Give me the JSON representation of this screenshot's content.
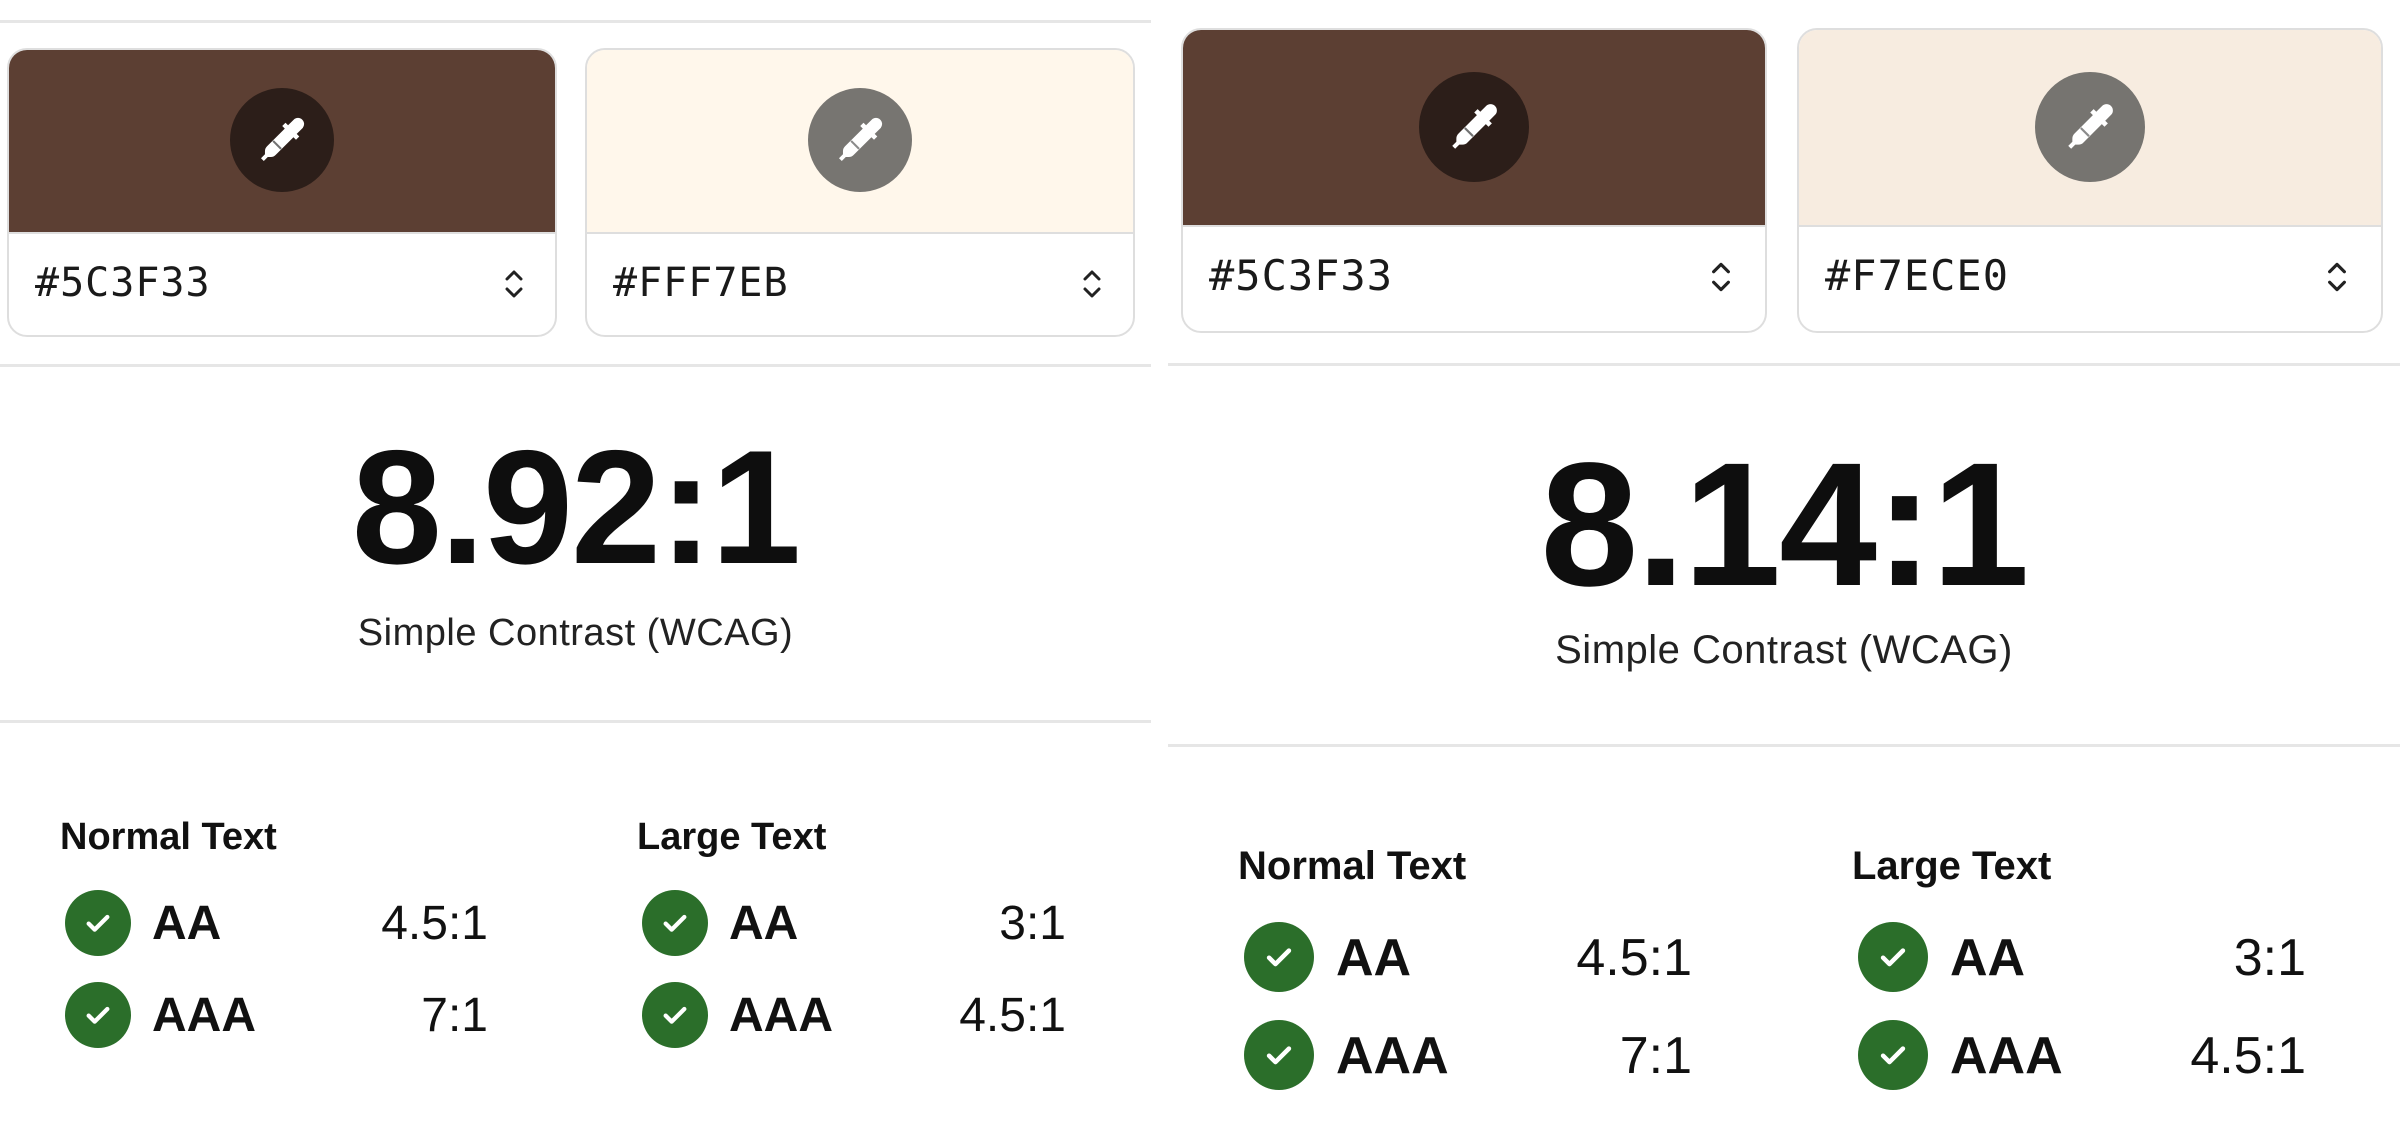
{
  "colors": {
    "accent_check": "#2B6E2A",
    "divider": "#E6E6E6"
  },
  "left": {
    "foreground": {
      "hex": "#5C3F33",
      "swatch": "#5C3F33",
      "picker_bg": "#2C1E19",
      "icon": "eyedropper-icon"
    },
    "background": {
      "hex": "#FFF7EB",
      "swatch": "#FFF7EB",
      "picker_bg": "#777571",
      "icon": "eyedropper-icon"
    },
    "ratio": "8.92:1",
    "ratio_label": "Simple Contrast (WCAG)",
    "normal_text": {
      "title": "Normal Text",
      "rows": [
        {
          "level": "AA",
          "ratio": "4.5:1"
        },
        {
          "level": "AAA",
          "ratio": "7:1"
        }
      ]
    },
    "large_text": {
      "title": "Large Text",
      "rows": [
        {
          "level": "AA",
          "ratio": "3:1"
        },
        {
          "level": "AAA",
          "ratio": "4.5:1"
        }
      ]
    }
  },
  "right": {
    "foreground": {
      "hex": "#5C3F33",
      "swatch": "#5C3F33",
      "picker_bg": "#2C1E19",
      "icon": "eyedropper-icon"
    },
    "background": {
      "hex": "#F7ECE0",
      "swatch": "#F7ECE0",
      "picker_bg": "#767470",
      "icon": "eyedropper-icon"
    },
    "ratio": "8.14:1",
    "ratio_label": "Simple Contrast (WCAG)",
    "normal_text": {
      "title": "Normal Text",
      "rows": [
        {
          "level": "AA",
          "ratio": "4.5:1"
        },
        {
          "level": "AAA",
          "ratio": "7:1"
        }
      ]
    },
    "large_text": {
      "title": "Large Text",
      "rows": [
        {
          "level": "AA",
          "ratio": "3:1"
        },
        {
          "level": "AAA",
          "ratio": "4.5:1"
        }
      ]
    }
  }
}
